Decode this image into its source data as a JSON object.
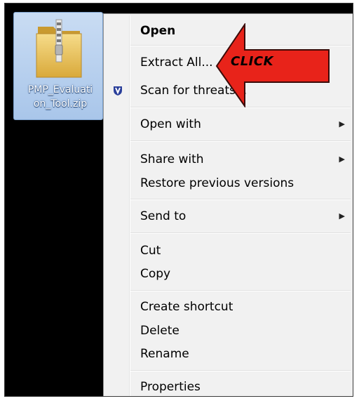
{
  "desktop": {
    "file_icon": "zip-folder-icon",
    "file_name_line1": "PMP_Evaluati",
    "file_name_line2": "on_Tool.zip"
  },
  "context_menu": {
    "items": [
      {
        "label": "Open",
        "bold": true
      },
      {
        "label": "Extract All..."
      },
      {
        "label": "Scan for threats...",
        "icon": "shield-icon"
      },
      {
        "label": "Open with",
        "submenu": true
      },
      {
        "label": "Share with",
        "submenu": true
      },
      {
        "label": "Restore previous versions"
      },
      {
        "label": "Send to",
        "submenu": true
      },
      {
        "label": "Cut"
      },
      {
        "label": "Copy"
      },
      {
        "label": "Create shortcut"
      },
      {
        "label": "Delete"
      },
      {
        "label": "Rename"
      },
      {
        "label": "Properties"
      }
    ],
    "submenu_arrow": "▶"
  },
  "annotation": {
    "text": "CLICK",
    "arrow_color": "#e8231a"
  }
}
